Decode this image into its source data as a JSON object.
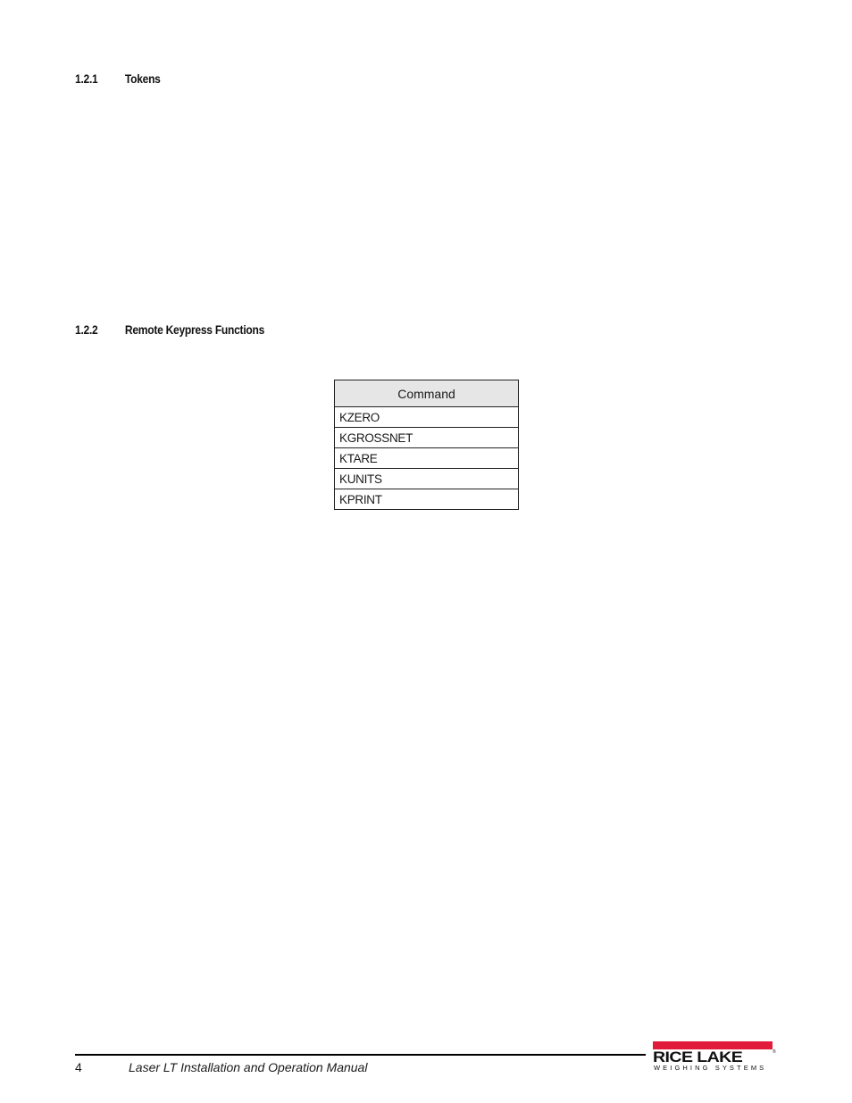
{
  "sections": [
    {
      "number": "1.2.1",
      "title": "Tokens"
    },
    {
      "number": "1.2.2",
      "title": "Remote Keypress Functions"
    }
  ],
  "command_table": {
    "header": "Command",
    "rows": [
      "KZERO",
      "KGROSSNET",
      "KTARE",
      "KUNITS",
      "KPRINT"
    ]
  },
  "footer": {
    "page_number": "4",
    "manual_title": "Laser LT Installation and Operation Manual",
    "logo": {
      "name": "RICE LAKE",
      "registered": "®",
      "tagline": "WEIGHING SYSTEMS",
      "brand_color": "#e31b3a"
    }
  }
}
